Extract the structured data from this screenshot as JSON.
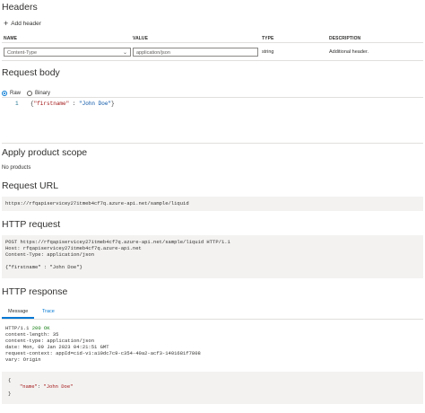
{
  "headers_section": {
    "title": "Headers",
    "add_label": "Add header",
    "columns": [
      "NAME",
      "VALUE",
      "TYPE",
      "DESCRIPTION"
    ],
    "rows": [
      {
        "name": "Content-Type",
        "value": "application/json",
        "type": "string",
        "description": "Additional header."
      }
    ]
  },
  "request_body": {
    "title": "Request body",
    "radio_raw": "Raw",
    "radio_binary": "Binary",
    "selected": "Raw",
    "line_number": "1",
    "code_open": "{",
    "code_key": "\"firstname\"",
    "code_colon": " : ",
    "code_value": "\"John Doe\"",
    "code_close": "}"
  },
  "product_scope": {
    "title": "Apply product scope",
    "value": "No products"
  },
  "request_url": {
    "title": "Request URL",
    "value": "https://rfqapiservicey27itmeb4cf7q.azure-api.net/sample/liquid"
  },
  "http_request": {
    "title": "HTTP request",
    "lines": [
      "POST https://rfqapiservicey27itmeb4cf7q.azure-api.net/sample/liquid HTTP/1.1",
      "Host: rfqapiservicey27itmeb4cf7q.azure-api.net",
      "Content-Type: application/json",
      "",
      "{\"firstname\" : \"John Doe\"}"
    ]
  },
  "http_response": {
    "title": "HTTP response",
    "tabs": [
      "Message",
      "Trace"
    ],
    "active_tab": "Message",
    "status_prefix": "HTTP/1.1 ",
    "status_code": "200 OK",
    "header_lines": [
      "content-length: 35",
      "content-type: application/json",
      "date: Mon, 09 Jan 2023 04:21:51 GMT",
      "request-context: appId=cid-v1:a10dc7c9-c354-40a2-acf3-1401681f7808",
      "vary: Origin"
    ],
    "body_open": "{",
    "body_key": "\"name\"",
    "body_sep": ": ",
    "body_value": "\"John Doe\"",
    "body_close": "}"
  },
  "colors": {
    "accent": "#0078d4",
    "success": "#107c10",
    "json_key": "#a31515"
  }
}
